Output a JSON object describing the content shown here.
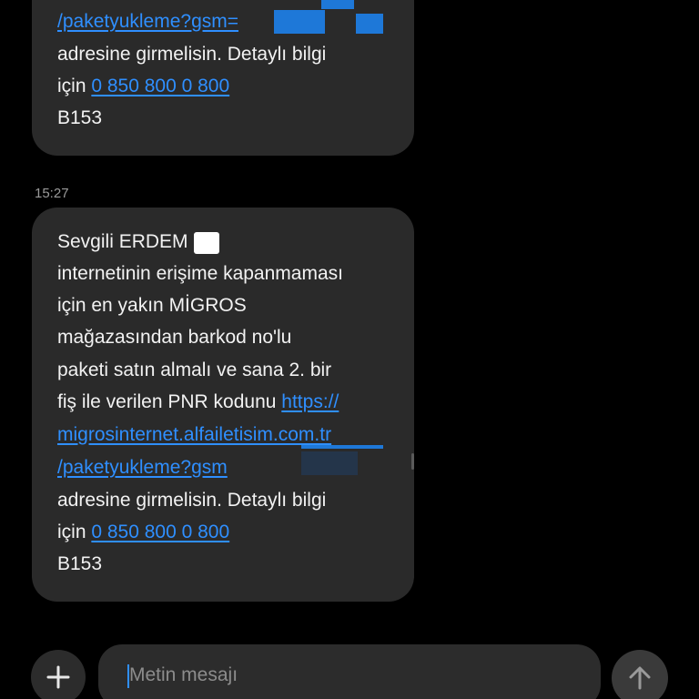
{
  "messages": [
    {
      "lines": {
        "l1": "/paketyukleme?gsm=",
        "l2": "adresine girmelisin. Detaylı bilgi",
        "l3_prefix": "için",
        "l3_link": "0 850 800 0 800",
        "l4": "B153"
      }
    },
    {
      "timestamp": "15:27",
      "lines": {
        "l1": "Sevgili ERDEM",
        "l2": "internetinin erişime kapanmaması",
        "l3": "için en yakın MİGROS",
        "l4": "mağazasından  barkod no'lu",
        "l5": "paketi satın almalı ve sana 2. bir",
        "l6_prefix": "fiş ile verilen PNR kodunu",
        "l6_link": "https://",
        "l7_link": "migrosinternet.alfailetisim.com.tr",
        "l8_link": "/paketyukleme?gsm",
        "l9": "adresine girmelisin. Detaylı bilgi",
        "l10_prefix": "için",
        "l10_link": "0 850 800 0 800",
        "l11": "B153"
      }
    }
  ],
  "composer": {
    "placeholder": "Metin mesajı",
    "add_icon": "plus-icon",
    "send_icon": "arrow-up-icon"
  },
  "colors": {
    "background": "#000000",
    "bubble": "#2a2a2a",
    "link": "#2f8fff",
    "text": "#f2f2f2",
    "timestamp": "#9a9a9a"
  }
}
